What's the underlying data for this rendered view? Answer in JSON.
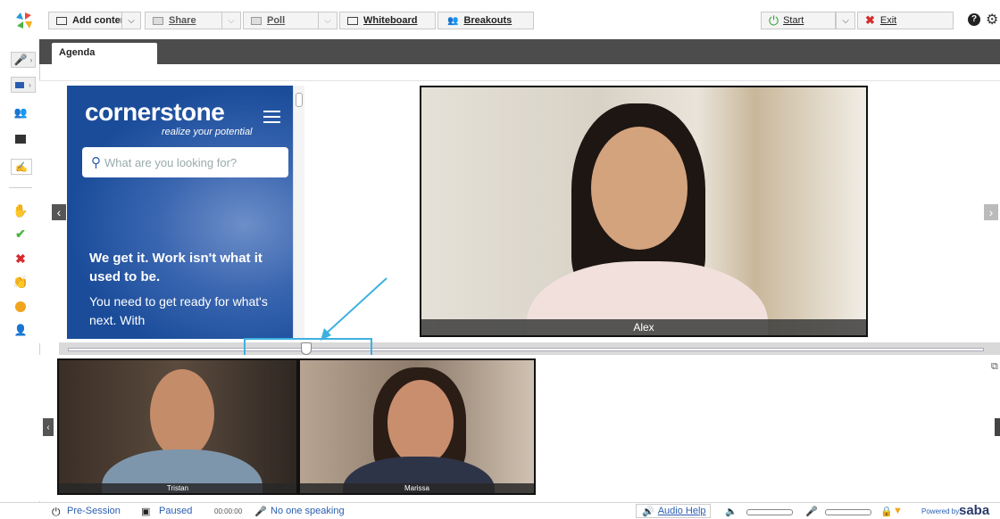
{
  "toolbar": {
    "add_content": "Add content",
    "share": "Share",
    "poll": "Poll",
    "whiteboard": "Whiteboard",
    "breakouts": "Breakouts",
    "start": "Start",
    "exit": "Exit"
  },
  "tabs": [
    {
      "label": "Agenda"
    }
  ],
  "shared_page": {
    "logo": "cornerstone",
    "tagline": "realize your potential",
    "search_placeholder": "What are you looking for?",
    "headline": "We get it. Work isn't what it used to be.",
    "body": "You need to get ready for what's next. With"
  },
  "main_video": {
    "name": "Alex"
  },
  "thumbnails": [
    {
      "name": "Tristan"
    },
    {
      "name": "Marissa"
    }
  ],
  "status": {
    "session": "Pre-Session",
    "recording": "Paused",
    "timer": "00:00:00",
    "speaker": "No one speaking",
    "audio_help": "Audio Help",
    "powered_by": "Powered by",
    "brand": "saba"
  },
  "colors": {
    "accent_blue": "#2a5db0",
    "start_green": "#2f9e2f",
    "exit_red": "#d62b2b",
    "highlight": "#3cb1e0",
    "tabbar": "#4c4c4c"
  }
}
